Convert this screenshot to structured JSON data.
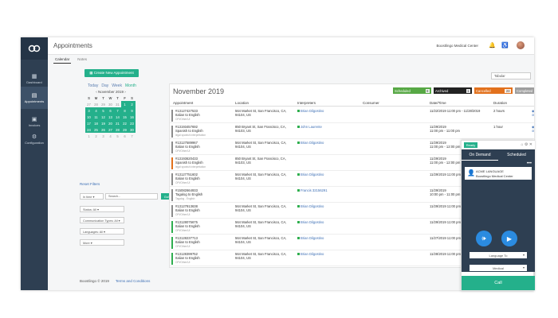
{
  "app": {
    "page_title": "Appointments",
    "org_name": "Boostlingo Medical Center",
    "footer_copy": "Boostlingo © 2019",
    "footer_link": "Terms and Conditions"
  },
  "sidebar": {
    "items": [
      {
        "label": "Dashboard",
        "icon": "dashboard-icon"
      },
      {
        "label": "Appointments",
        "icon": "calendar-icon"
      },
      {
        "label": "Invoices",
        "icon": "invoice-icon"
      },
      {
        "label": "Configuration",
        "icon": "gear-icon"
      }
    ]
  },
  "tabs": [
    "Calendar",
    "Notes"
  ],
  "create_label": "▦ Create New Appointment",
  "calendar": {
    "views": [
      "Day",
      "Week",
      "Month"
    ],
    "today_label": "Today",
    "header": "‹   November 2019   ›",
    "weekdays": [
      "S",
      "M",
      "T",
      "W",
      "T",
      "F",
      "S"
    ],
    "cells": [
      "27",
      "28",
      "29",
      "30",
      "31",
      "1",
      "2",
      "3",
      "4",
      "5",
      "6",
      "7",
      "8",
      "9",
      "10",
      "11",
      "12",
      "13",
      "14",
      "15",
      "16",
      "17",
      "18",
      "19",
      "20",
      "21",
      "22",
      "23",
      "24",
      "25",
      "26",
      "27",
      "28",
      "29",
      "30",
      "1",
      "2",
      "3",
      "4",
      "5",
      "6",
      "7"
    ]
  },
  "filters": {
    "reset_label": "Reset Filters",
    "filter_by": "In time ▾",
    "search_placeholder": "Search...",
    "go_label": "Go!",
    "status": "Status: All ▾",
    "comm_types": "Communication Types: All ▾",
    "languages": "Languages: All ▾",
    "more": "More ▾"
  },
  "panel": {
    "month": "November 2019",
    "view_select": "Tabular",
    "statuses": [
      {
        "label": "Scheduled",
        "count": "8",
        "color": "#57a845"
      },
      {
        "label": "Archived",
        "count": "1",
        "color": "#222222"
      },
      {
        "label": "Cancelled",
        "count": "23",
        "color": "#e2711d"
      },
      {
        "label": "Completed",
        "count": "88",
        "color": "#9e9e9e"
      }
    ],
    "columns": [
      "Appointment",
      "Location",
      "Interpreters",
      "Consumer",
      "Date/Time",
      "Duration"
    ],
    "rows": [
      {
        "id": "#13127427533",
        "lang": "Italian to English",
        "sub": "OPI/Other/UI",
        "loc1": "564 Market St, San Francisco, CA,",
        "loc2": "94104, US",
        "interp": "Brian Dilgostino",
        "date1": "11/22/2019 11:00 pm - 11/28/2019",
        "date2": "",
        "dur": "2 hours",
        "act1": "◉ Open",
        "act2": "⊘ Done",
        "color": "#8c8c8c"
      },
      {
        "id": "#13193457692",
        "lang": "Spanish to English",
        "sub": "legal spanish interpretation",
        "loc1": "850 Bryant St, San Francisco, CA,",
        "loc2": "94103, US",
        "interp": "John Laurente",
        "date1": "11/29/2019",
        "date2": "11:00 pm - 11:00 pm",
        "dur": "1 hour",
        "act1": "◉ Open",
        "act2": "⊘ Done",
        "color": "#8c8c8c"
      },
      {
        "id": "#13127589967",
        "lang": "Italian to English",
        "sub": "OPI/Other/UI",
        "loc1": "564 Market St, San Francisco, CA,",
        "loc2": "94104, US",
        "interp": "Brian Dilgostino",
        "date1": "11/29/2019",
        "date2": "11:00 pm - 12:00 pm",
        "dur": "",
        "act1": "",
        "act2": "",
        "color": "#8c8c8c"
      },
      {
        "id": "#13193620433",
        "lang": "Spanish to English",
        "sub": "legal spanish interpretation",
        "loc1": "850 Bryant St, San Francisco, CA,",
        "loc2": "94103, US",
        "interp": "",
        "date1": "11/29/2019",
        "date2": "11:00 pm - 12:00 pm",
        "dur": "",
        "act1": "",
        "act2": "",
        "color": "#e2711d"
      },
      {
        "id": "#13127751602",
        "lang": "Italian to English",
        "sub": "OPI/Other/UI",
        "loc1": "564 Market St, San Francisco, CA,",
        "loc2": "94104, US",
        "interp": "Brian Dilgostino",
        "date1": "11/29/2019 11:00 pm - 11/29/2019",
        "date2": "",
        "dur": "",
        "act1": "",
        "act2": "",
        "color": "#8c8c8c"
      },
      {
        "id": "#15082664933",
        "lang": "Tagalog to English",
        "sub": "Tagalog - English",
        "loc1": "",
        "loc2": "",
        "interp": "Francis 32156291",
        "date1": "11/29/2019",
        "date2": "10:00 pm - 11:00 pm",
        "dur": "",
        "act1": "",
        "act2": "",
        "color": "#8c8c8c"
      },
      {
        "id": "#13127913638",
        "lang": "Italian to English",
        "sub": "OPI/Other/UI",
        "loc1": "564 Market St, San Francisco, CA,",
        "loc2": "94104, US",
        "interp": "Brian Dilgostino",
        "date1": "11/29/2019 11:00 pm - 11/30/2019",
        "date2": "",
        "dur": "",
        "act1": "",
        "act2": "",
        "color": "#8c8c8c"
      },
      {
        "id": "#13128075675",
        "lang": "Italian to English",
        "sub": "OPI/Other/UI",
        "loc1": "564 Market St, San Francisco, CA,",
        "loc2": "94104, US",
        "interp": "Brian Dilgostino",
        "date1": "11/29/2019 11:00 pm - 11/27/2019",
        "date2": "",
        "dur": "",
        "act1": "",
        "act2": "",
        "color": "#2fae4f"
      },
      {
        "id": "#13128237713",
        "lang": "Italian to English",
        "sub": "OPI/Other/UI",
        "loc1": "564 Market St, San Francisco, CA,",
        "loc2": "94104, US",
        "interp": "Brian Dilgostino",
        "date1": "11/27/2019 11:00 pm - 11/28/2019",
        "date2": "",
        "dur": "",
        "act1": "",
        "act2": "",
        "color": "#2fae4f"
      },
      {
        "id": "#13128399752",
        "lang": "Italian to English",
        "sub": "OPI/Other/UI",
        "loc1": "564 Market St, San Francisco, CA,",
        "loc2": "94104, US",
        "interp": "Brian Dilgostino",
        "date1": "11/28/2019 11:00 pm - 11/29/2019",
        "date2": "",
        "dur": "",
        "act1": "",
        "act2": "",
        "color": "#2fae4f"
      }
    ]
  },
  "widget": {
    "ready": "Ready",
    "status_icons": "⌂ ⚙ ✕",
    "tabs": [
      "On Demand",
      "Scheduled"
    ],
    "menu": "•••",
    "card_name": "ACME LANGUAGE",
    "card_org": "Boostlingo Medical Center",
    "language_select": "Language To",
    "specialty_select": "Medical",
    "call_label": "Call"
  }
}
